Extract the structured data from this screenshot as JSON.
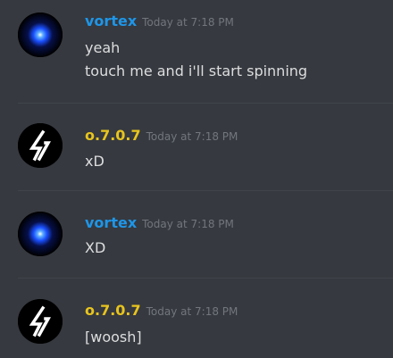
{
  "colors": {
    "background": "#36393f",
    "username_vortex": "#1e96e8",
    "username_o707": "#e8c41e",
    "text": "#dcddde",
    "timestamp": "#72767d"
  },
  "messages": [
    {
      "avatar_icon": "blue-orb-avatar",
      "username": "vortex",
      "timestamp": "Today at 7:18 PM",
      "lines": [
        "yeah",
        "touch me and i'll start spinning"
      ]
    },
    {
      "avatar_icon": "lightning-bolt-avatar",
      "username": "o.7.0.7",
      "timestamp": "Today at 7:18 PM",
      "lines": [
        "xD"
      ]
    },
    {
      "avatar_icon": "blue-orb-avatar",
      "username": "vortex",
      "timestamp": "Today at 7:18 PM",
      "lines": [
        "XD"
      ]
    },
    {
      "avatar_icon": "lightning-bolt-avatar",
      "username": "o.7.0.7",
      "timestamp": "Today at 7:18 PM",
      "lines": [
        "[woosh]"
      ]
    }
  ]
}
